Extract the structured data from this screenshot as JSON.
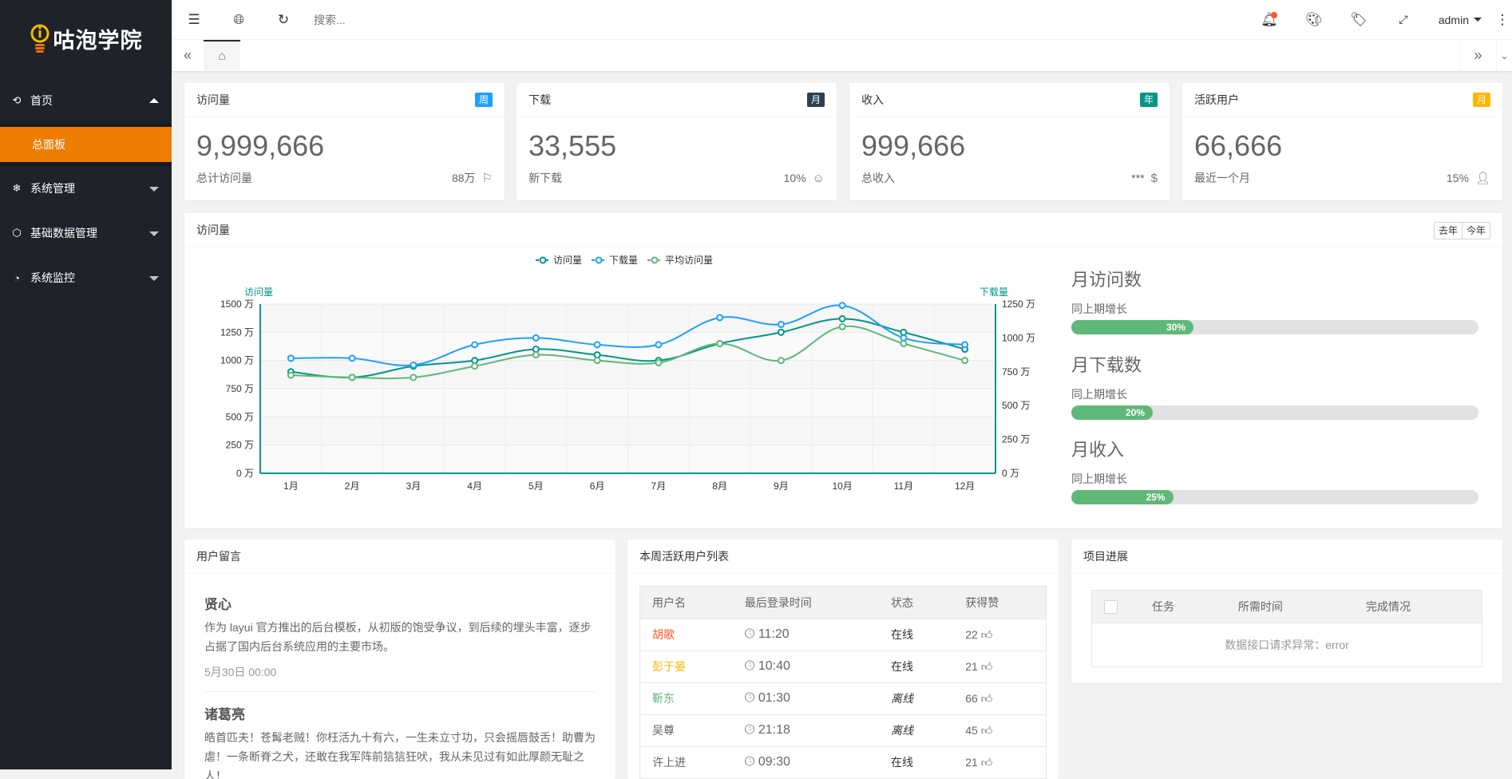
{
  "app": {
    "logo_text": "咕泡学院"
  },
  "sidebar": {
    "items": [
      {
        "label": "首页",
        "icon": "home-icon",
        "expanded": true,
        "children": [
          {
            "label": "总面板",
            "active": true
          }
        ]
      },
      {
        "label": "系统管理",
        "icon": "snowflake-icon"
      },
      {
        "label": "基础数据管理",
        "icon": "cube-icon"
      },
      {
        "label": "系统监控",
        "icon": "dashboard-icon"
      }
    ]
  },
  "header": {
    "search_placeholder": "搜索...",
    "user": "admin",
    "icons": [
      "shrink-icon",
      "globe-icon",
      "refresh-icon",
      "bell-icon",
      "theme-icon",
      "tag-icon",
      "fullscreen-icon",
      "more-icon"
    ]
  },
  "stats": [
    {
      "title": "访问量",
      "badge": "周",
      "badge_color": "#1E9FFF",
      "value": "9,999,666",
      "label": "总计访问量",
      "extra": "88万",
      "icon": "flag-icon"
    },
    {
      "title": "下载",
      "badge": "月",
      "badge_color": "#2F4056",
      "value": "33,555",
      "label": "新下载",
      "extra": "10%",
      "icon": "smile-icon"
    },
    {
      "title": "收入",
      "badge": "年",
      "badge_color": "#009688",
      "value": "999,666",
      "label": "总收入",
      "extra": "***",
      "icon": "dollar-icon"
    },
    {
      "title": "活跃用户",
      "badge": "月",
      "badge_color": "#FFB800",
      "value": "66,666",
      "label": "最近一个月",
      "extra": "15%",
      "icon": "user-icon"
    }
  ],
  "chart_panel": {
    "title": "访问量",
    "buttons": [
      "去年",
      "今年"
    ]
  },
  "chart_data": {
    "type": "line",
    "categories": [
      "1月",
      "2月",
      "3月",
      "4月",
      "5月",
      "6月",
      "7月",
      "8月",
      "9月",
      "10月",
      "11月",
      "12月"
    ],
    "series": [
      {
        "name": "访问量",
        "axis": "left",
        "color": "#009688",
        "values": [
          900,
          850,
          950,
          1000,
          1100,
          1050,
          1000,
          1150,
          1250,
          1370,
          1250,
          1100
        ]
      },
      {
        "name": "下载量",
        "axis": "right",
        "color": "#1E9FFF",
        "values": [
          850,
          850,
          800,
          950,
          1000,
          950,
          950,
          1150,
          1100,
          1240,
          1000,
          950
        ]
      },
      {
        "name": "平均访问量",
        "axis": "left",
        "color": "#5FB878",
        "values": [
          870,
          850,
          850,
          950,
          1050,
          1000,
          980,
          1150,
          1000,
          1300,
          1150,
          1000
        ]
      }
    ],
    "left_axis": {
      "name": "访问量",
      "range": [
        0,
        1500
      ],
      "ticks": [
        "0 万",
        "250 万",
        "500 万",
        "750 万",
        "1000 万",
        "1250 万",
        "1500 万"
      ]
    },
    "right_axis": {
      "name": "下载量",
      "range": [
        0,
        1250
      ],
      "ticks": [
        "0 万",
        "250 万",
        "500 万",
        "750 万",
        "1000 万",
        "1250 万"
      ]
    },
    "legend": "top-center",
    "grid": true,
    "smooth": true
  },
  "progress": [
    {
      "title": "月访问数",
      "label": "同上期增长",
      "percent": 30,
      "text": "30%"
    },
    {
      "title": "月下载数",
      "label": "同上期增长",
      "percent": 20,
      "text": "20%"
    },
    {
      "title": "月收入",
      "label": "同上期增长",
      "percent": 25,
      "text": "25%"
    }
  ],
  "messages": {
    "title": "用户留言",
    "items": [
      {
        "name": "贤心",
        "text": "作为 layui 官方推出的后台模板，从初版的饱受争议，到后续的埋头丰富，逐步占据了国内后台系统应用的主要市场。",
        "time": "5月30日 00:00"
      },
      {
        "name": "诸葛亮",
        "text": "皓首匹夫！苍髯老贼！你枉活九十有六，一生未立寸功，只会摇唇鼓舌！助曹为虐！一条断脊之犬，还敢在我军阵前狺狺狂吠，我从未见过有如此厚颜无耻之人！"
      }
    ]
  },
  "active_users": {
    "title": "本周活跃用户列表",
    "columns": [
      "用户名",
      "最后登录时间",
      "状态",
      "获得赞"
    ],
    "rows": [
      {
        "name": "胡歌",
        "color": "#FF5722",
        "time": "11:20",
        "status": "在线",
        "likes": "22"
      },
      {
        "name": "彭于晏",
        "color": "#FFB800",
        "time": "10:40",
        "status": "在线",
        "likes": "21"
      },
      {
        "name": "靳东",
        "color": "#5FB878",
        "time": "01:30",
        "status": "离线",
        "likes": "66"
      },
      {
        "name": "吴尊",
        "color": "#666666",
        "time": "21:18",
        "status": "离线",
        "likes": "45"
      },
      {
        "name": "许上进",
        "color": "#666666",
        "time": "09:30",
        "status": "在线",
        "likes": "21"
      }
    ]
  },
  "projects": {
    "title": "项目进展",
    "columns": [
      "任务",
      "所需时间",
      "完成情况"
    ],
    "empty": "数据接口请求异常：error"
  }
}
